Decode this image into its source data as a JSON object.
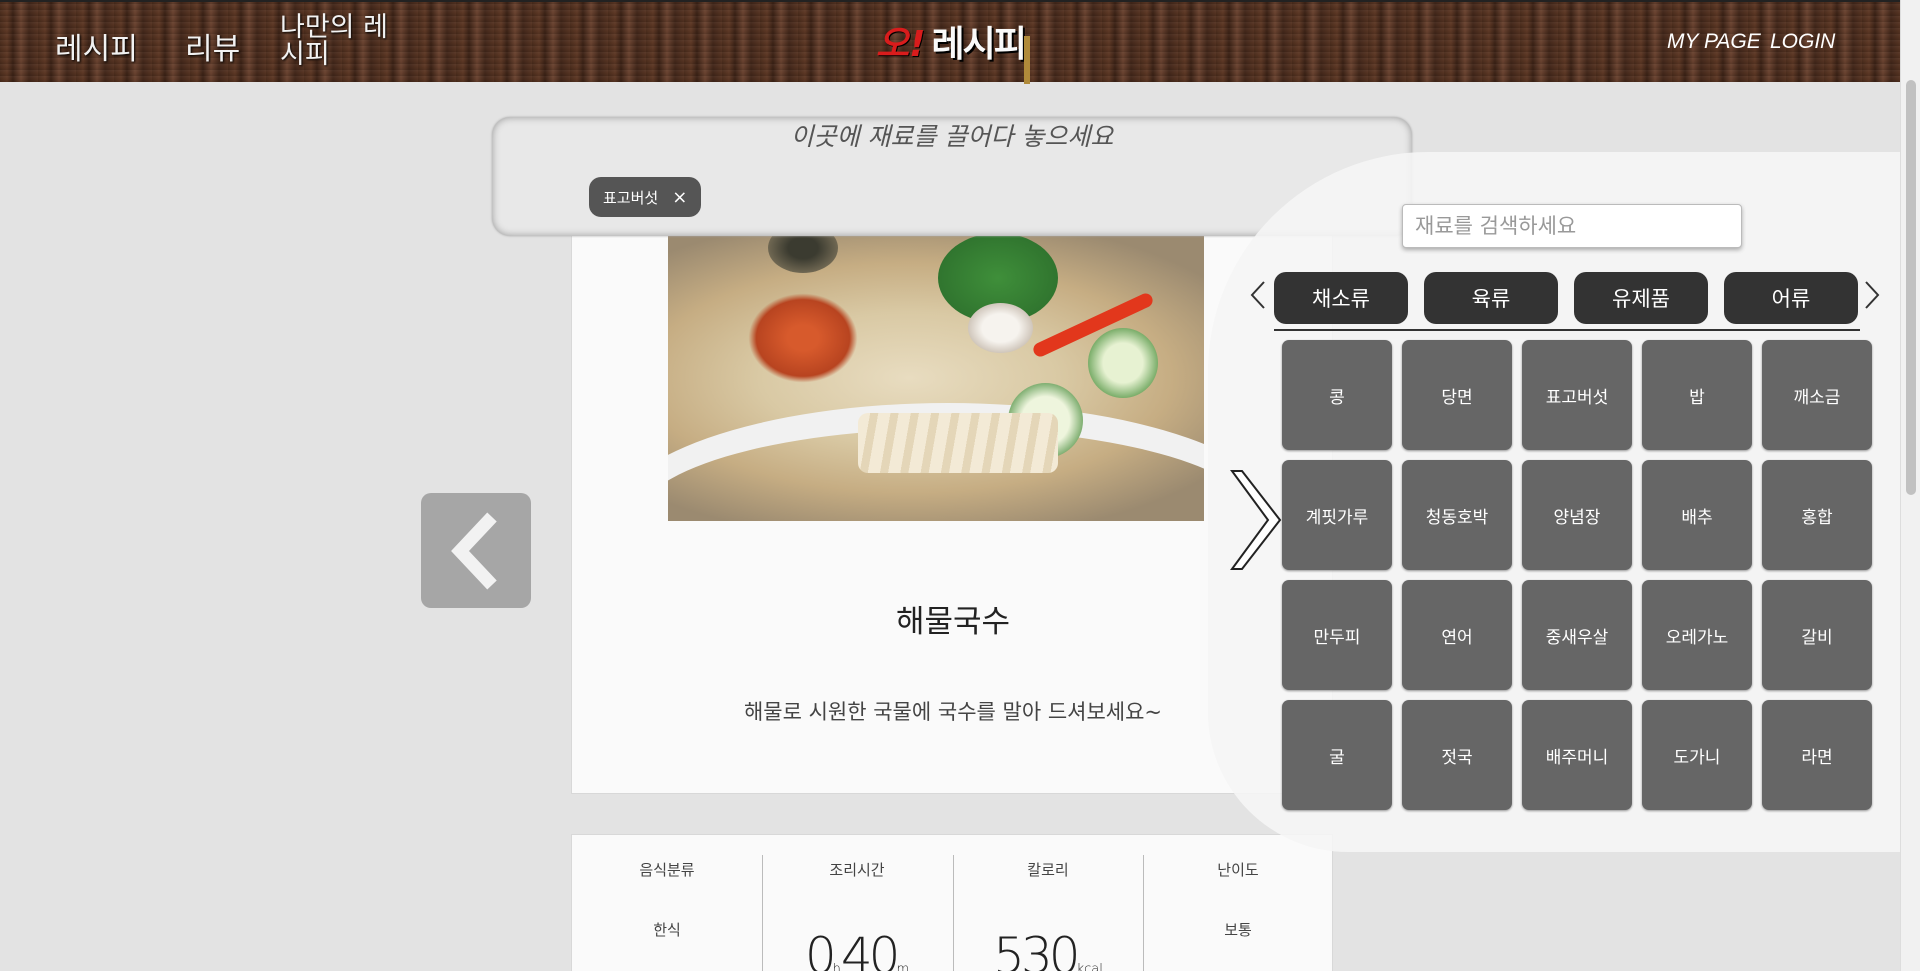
{
  "header": {
    "nav": [
      "레시피",
      "리뷰",
      "나만의 레시피"
    ],
    "logo_o": "오!",
    "logo_text": "레시피",
    "mypage": "MY PAGE",
    "login": "LOGIN"
  },
  "dropzone": {
    "title": "이곳에 재료를 끌어다 놓으세요",
    "chips": [
      {
        "label": "표고버섯",
        "close": "×"
      }
    ]
  },
  "recipe": {
    "title": "해물국수",
    "description": "해물로 시원한 국물에 국수를 말아 드셔보세요~"
  },
  "info": {
    "category_label": "음식분류",
    "category_value": "한식",
    "time_label": "조리시간",
    "time_hours": "0",
    "time_h_unit": "h",
    "time_minutes": "40",
    "time_m_unit": "m",
    "calorie_label": "칼로리",
    "calorie_value": "530",
    "calorie_unit": "kcal",
    "difficulty_label": "난이도",
    "difficulty_value": "보통"
  },
  "panel": {
    "search_placeholder": "재료를 검색하세요",
    "categories": [
      "채소류",
      "육류",
      "유제품",
      "어류"
    ],
    "ingredients": [
      "콩",
      "당면",
      "표고버섯",
      "밥",
      "깨소금",
      "계핏가루",
      "청동호박",
      "양념장",
      "배추",
      "홍합",
      "만두피",
      "연어",
      "중새우살",
      "오레가노",
      "갈비",
      "굴",
      "젓국",
      "배주머니",
      "도가니",
      "라면"
    ]
  },
  "icons": {
    "prev": "chevron-left-icon",
    "next": "chevron-right-icon"
  }
}
